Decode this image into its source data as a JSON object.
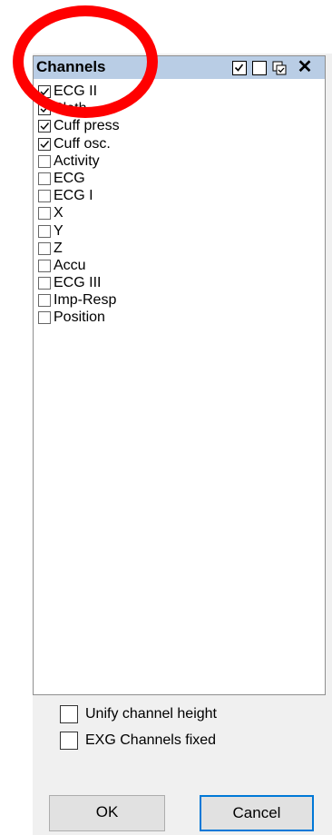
{
  "header": {
    "title": "Channels",
    "buttons": [
      "check-all-icon",
      "uncheck-all-icon",
      "invert-selection-icon",
      "close-icon"
    ]
  },
  "channels": [
    {
      "label": "ECG II",
      "checked": true
    },
    {
      "label": "Pleth",
      "checked": true
    },
    {
      "label": "Cuff press",
      "checked": true
    },
    {
      "label": "Cuff osc.",
      "checked": true
    },
    {
      "label": "Activity",
      "checked": false
    },
    {
      "label": "ECG",
      "checked": false
    },
    {
      "label": "ECG I",
      "checked": false
    },
    {
      "label": "X",
      "checked": false
    },
    {
      "label": "Y",
      "checked": false
    },
    {
      "label": "Z",
      "checked": false
    },
    {
      "label": "Accu",
      "checked": false
    },
    {
      "label": "ECG III",
      "checked": false
    },
    {
      "label": "Imp-Resp",
      "checked": false
    },
    {
      "label": "Position",
      "checked": false
    }
  ],
  "options": {
    "unify_label": "Unify channel height",
    "unify_checked": false,
    "exg_label": "EXG Channels fixed",
    "exg_checked": false
  },
  "buttons": {
    "ok": "OK",
    "cancel": "Cancel"
  },
  "colors": {
    "header_bg": "#b9cde5",
    "annotation": "#ff0000",
    "focus_border": "#0078d7"
  }
}
